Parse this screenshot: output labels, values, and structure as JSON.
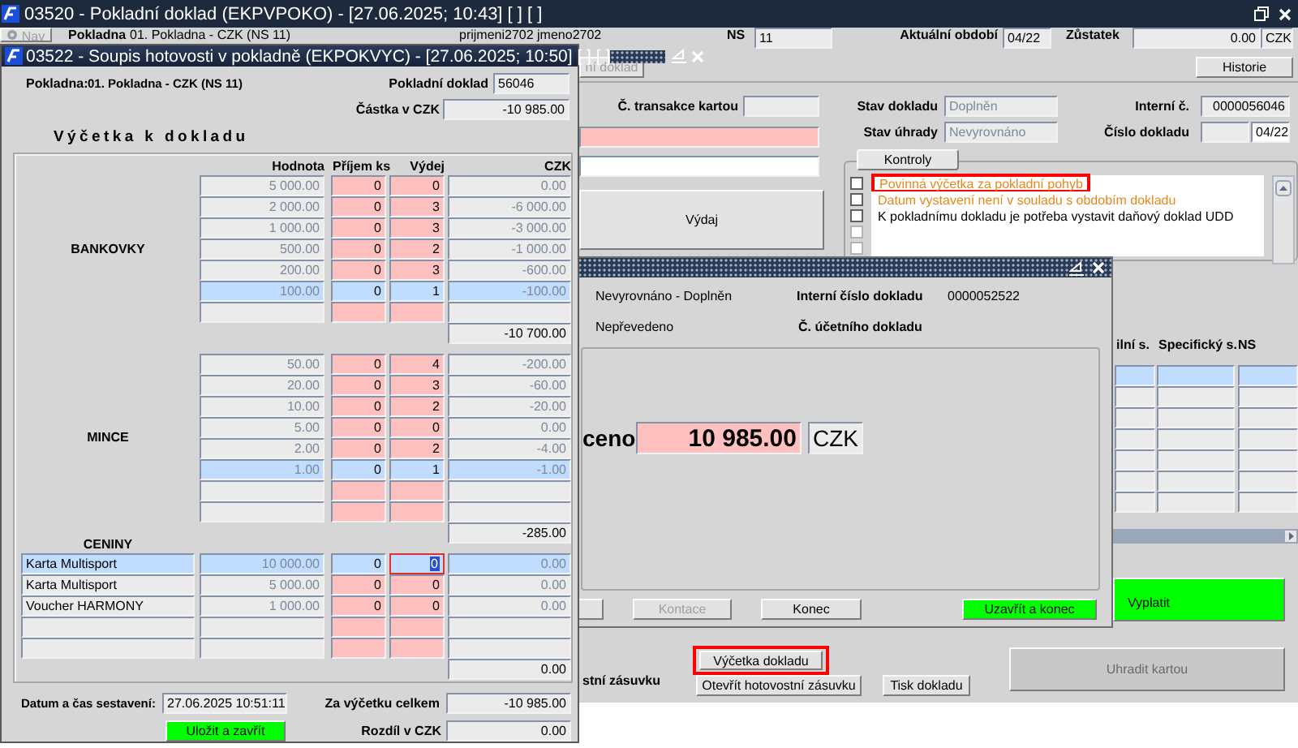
{
  "main_window": {
    "title": "03520 - Pokladní doklad (EKPVPOKO) - [27.06.2025; 10:43] [ ] [ ]",
    "nav_button": {
      "label": "Nav",
      "disabled": true
    },
    "cashbox_label": "Pokladna",
    "cashbox": "01. Pokladna - CZK (NS 11)",
    "user": "prijmeni2702 jmeno2702",
    "ns_label": "NS",
    "ns": "11",
    "period_label": "Aktuální období",
    "period": "04/22",
    "balance_label": "Zůstatek",
    "balance": "0.00",
    "currency": "CZK",
    "doc_button": "ní doklad",
    "history_button": "Historie",
    "card_txn_label": "Č. transakce kartou",
    "expense_button": "Výdaj",
    "status_label": "Stav dokladu",
    "status": "Doplněn",
    "payment_label": "Stav úhrady",
    "payment": "Nevyrovnáno",
    "internal_label": "Interní č.",
    "internal": "0000056046",
    "number_label": "Číslo dokladu",
    "number": "04/22",
    "checks_tab": {
      "label": "Kontroly",
      "selected": true
    },
    "checks": [
      {
        "kind": "message",
        "text": "Povinná výčetka za pokladní pohyb",
        "color": "#e8891c",
        "checked": false,
        "disabled": false,
        "highlighted": true
      },
      {
        "kind": "message",
        "text": "Datum vystavení není v souladu s obdobím dokladu",
        "color": "#e8891c",
        "checked": false,
        "disabled": false,
        "highlighted": false
      },
      {
        "kind": "message",
        "text": "K pokladnímu dokladu je potřeba vystavit daňový doklad UDD",
        "color": "#000000",
        "checked": false,
        "disabled": false,
        "highlighted": false
      },
      {
        "kind": "blank",
        "checked": false,
        "disabled": true
      },
      {
        "kind": "blank",
        "checked": false,
        "disabled": true
      }
    ],
    "grid": {
      "columns": [
        "ilní s.",
        "Specifický s.",
        "NS"
      ],
      "rows": [
        {
          "selected": true
        },
        {
          "selected": false
        },
        {
          "selected": false
        },
        {
          "selected": false
        },
        {
          "selected": false
        },
        {
          "selected": false
        },
        {
          "selected": false
        }
      ]
    },
    "pay_button": "Vyplatit",
    "card_pay_button": {
      "label": "Uhradit kartou",
      "disabled": true
    },
    "drawer_label": "stní zásuvku",
    "count_button": {
      "label": "Výčetka dokladu",
      "highlighted": true
    },
    "open_drawer_button": "Otevřít hotovostní zásuvku",
    "print_button": "Tisk dokladu"
  },
  "posting_dialog": {
    "status": "Nevyrovnáno - Doplněn",
    "internal_label": "Interní číslo dokladu",
    "internal": "0000052522",
    "transfer": "Nepřevedeno",
    "account_doc_label": "Č. účetního dokladu",
    "amount_label": "ceno",
    "amount": "10 985.00",
    "currency": "CZK",
    "buttons": [
      {
        "label": "Kontace",
        "kind": "plain",
        "disabled": true
      },
      {
        "label": "Konec",
        "kind": "plain",
        "disabled": false
      },
      {
        "label": "Uzavřít a konec",
        "kind": "primary",
        "disabled": false
      }
    ]
  },
  "count_dialog": {
    "title": "03522 - Soupis hotovosti v pokladně (EKPOKVYC) - [27.06.2025; 10:50] [ ] [ ]",
    "cashbox_label": "Pokladna:",
    "cashbox": "01. Pokladna - CZK (NS 11)",
    "doc_label": "Pokladní doklad",
    "doc": "56046",
    "amount_label": "Částka v CZK",
    "amount": "-10 985.00",
    "heading": "Výčetka k dokladu",
    "columns": [
      "Hodnota",
      "Příjem ks",
      "Výdej",
      "CZK"
    ],
    "sections": [
      {
        "kind": "denominations",
        "label": "BANKOVKY",
        "subtotal": "-10 700.00",
        "rows": [
          {
            "kind": "item",
            "value": "5 000.00",
            "received": "0",
            "issued": "0",
            "czk": "0.00",
            "selected": false
          },
          {
            "kind": "item",
            "value": "2 000.00",
            "received": "0",
            "issued": "3",
            "czk": "-6 000.00",
            "selected": false
          },
          {
            "kind": "item",
            "value": "1 000.00",
            "received": "0",
            "issued": "3",
            "czk": "-3 000.00",
            "selected": false
          },
          {
            "kind": "item",
            "value": "500.00",
            "received": "0",
            "issued": "2",
            "czk": "-1 000.00",
            "selected": false
          },
          {
            "kind": "item",
            "value": "200.00",
            "received": "0",
            "issued": "3",
            "czk": "-600.00",
            "selected": false
          },
          {
            "kind": "item",
            "value": "100.00",
            "received": "0",
            "issued": "1",
            "czk": "-100.00",
            "selected": true
          },
          {
            "kind": "blank",
            "selected": false
          }
        ]
      },
      {
        "kind": "denominations",
        "label": "MINCE",
        "subtotal": "-285.00",
        "rows": [
          {
            "kind": "item",
            "value": "50.00",
            "received": "0",
            "issued": "4",
            "czk": "-200.00",
            "selected": false
          },
          {
            "kind": "item",
            "value": "20.00",
            "received": "0",
            "issued": "3",
            "czk": "-60.00",
            "selected": false
          },
          {
            "kind": "item",
            "value": "10.00",
            "received": "0",
            "issued": "2",
            "czk": "-20.00",
            "selected": false
          },
          {
            "kind": "item",
            "value": "5.00",
            "received": "0",
            "issued": "0",
            "czk": "0.00",
            "selected": false
          },
          {
            "kind": "item",
            "value": "2.00",
            "received": "0",
            "issued": "2",
            "czk": "-4.00",
            "selected": false
          },
          {
            "kind": "item",
            "value": "1.00",
            "received": "0",
            "issued": "1",
            "czk": "-1.00",
            "selected": true
          },
          {
            "kind": "blank",
            "selected": false
          },
          {
            "kind": "blank",
            "selected": false
          }
        ]
      },
      {
        "kind": "vouchers",
        "label": "CENINY",
        "subtotal": "0.00",
        "rows": [
          {
            "kind": "item",
            "name": "Karta Multisport",
            "value": "10 000.00",
            "received": "0",
            "issued": "0",
            "czk": "0.00",
            "selected": true,
            "focused": true
          },
          {
            "kind": "item",
            "name": "Karta Multisport",
            "value": "5 000.00",
            "received": "0",
            "issued": "0",
            "czk": "0.00",
            "selected": false,
            "focused": false
          },
          {
            "kind": "item",
            "name": "Voucher HARMONY",
            "value": "1 000.00",
            "received": "0",
            "issued": "0",
            "czk": "0.00",
            "selected": false,
            "focused": false
          },
          {
            "kind": "blank",
            "selected": false,
            "focused": false
          },
          {
            "kind": "blank",
            "selected": false,
            "focused": false
          }
        ]
      }
    ],
    "date_label": "Datum a čas sestavení:",
    "date": "27.06.2025 10:51:11",
    "total_label": "Za výčetku celkem",
    "total": "-10 985.00",
    "save_button": "Uložit a zavřít",
    "diff_label": "Rozdíl v CZK",
    "diff": "0.00"
  }
}
